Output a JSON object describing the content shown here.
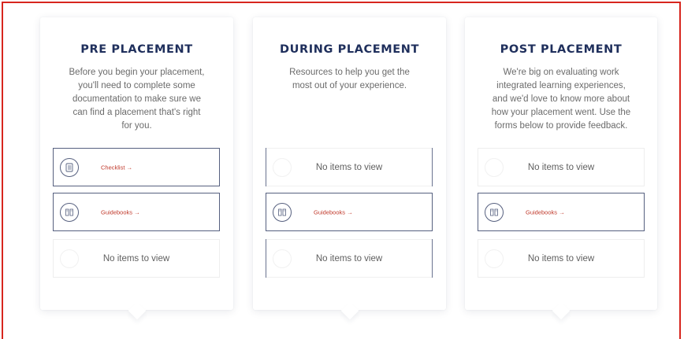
{
  "cards": [
    {
      "title": "PRE PLACEMENT",
      "description": [
        "Before you begin your placement,",
        "you'll need to complete some",
        "documentation to make sure we",
        "can find a placement that's right",
        "for you."
      ],
      "items": [
        {
          "type": "link",
          "label": "Checklist →",
          "icon": "checklist-icon"
        },
        {
          "type": "link",
          "label": "Guidebooks →",
          "icon": "guidebook-icon"
        },
        {
          "type": "empty",
          "label": "No items to view",
          "icon": "faded-placeholder-icon"
        }
      ]
    },
    {
      "title": "DURING PLACEMENT",
      "description": [
        "Resources to help you get the",
        "most out of your experience."
      ],
      "items": [
        {
          "type": "empty",
          "label": "No items to view",
          "icon": "faded-placeholder-icon"
        },
        {
          "type": "link",
          "label": "Guidebooks →",
          "icon": "guidebook-icon"
        },
        {
          "type": "empty",
          "label": "No items to view",
          "icon": "faded-placeholder-icon"
        }
      ]
    },
    {
      "title": "POST PLACEMENT",
      "description": [
        "We're big on evaluating work",
        "integrated learning experiences,",
        "and we'd love to know more about",
        "how your placement went. Use the",
        "forms below to provide feedback."
      ],
      "items": [
        {
          "type": "empty",
          "label": "No items to view",
          "icon": "faded-placeholder-icon"
        },
        {
          "type": "link",
          "label": "Guidebooks →",
          "icon": "guidebook-icon"
        },
        {
          "type": "empty",
          "label": "No items to view",
          "icon": "faded-placeholder-icon"
        }
      ]
    }
  ],
  "colors": {
    "title": "#1f2f5c",
    "link": "#c0392b",
    "frame": "#d7261e",
    "border": "#56607f"
  }
}
